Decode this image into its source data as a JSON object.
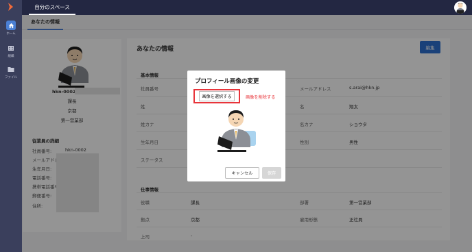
{
  "app": {
    "top_tab": "自分のスペース",
    "sub_tab": "あなたの情報"
  },
  "sidebar": {
    "items": [
      {
        "label": "ホーム",
        "icon": "home-icon"
      },
      {
        "label": "組織",
        "icon": "organization-icon"
      },
      {
        "label": "ファイル",
        "icon": "folder-icon"
      }
    ]
  },
  "profile": {
    "user_id": "hkn-0002・",
    "position": "課長",
    "location": "京都",
    "department": "第一営業部",
    "details_title": "従業員の詳細",
    "details": [
      {
        "label": "社員番号:",
        "value": "hkn-0002"
      },
      {
        "label": "メールアドレス:",
        "value": ""
      },
      {
        "label": "生年月日:",
        "value": ""
      },
      {
        "label": "電話番号:",
        "value": ""
      },
      {
        "label": "携帯電話番号:",
        "value": ""
      },
      {
        "label": "郵便番号:",
        "value": ""
      },
      {
        "label": "住所:",
        "value": ""
      }
    ]
  },
  "main": {
    "title": "あなたの情報",
    "edit_label": "編集",
    "basic": {
      "heading": "基本情報",
      "rows": [
        {
          "l1": "社員番号",
          "v1": "",
          "l2": "メールアドレス",
          "v2": "s.arai@hkn.jp"
        },
        {
          "l1": "姓",
          "v1": "",
          "l2": "名",
          "v2": "翔太"
        },
        {
          "l1": "姓カナ",
          "v1": "",
          "l2": "名カナ",
          "v2": "ショウタ"
        },
        {
          "l1": "生年月日",
          "v1": "",
          "l2": "性別",
          "v2": "男性"
        },
        {
          "l1": "ステータス",
          "v1": "",
          "l2": "",
          "v2": ""
        }
      ]
    },
    "work": {
      "heading": "仕事情報",
      "rows": [
        {
          "l1": "役職",
          "v1": "課長",
          "l2": "部署",
          "v2": "第一営業部"
        },
        {
          "l1": "拠点",
          "v1": "京都",
          "l2": "雇用形態",
          "v2": "正社員"
        },
        {
          "l1": "上司",
          "v1": "-",
          "l2": "",
          "v2": ""
        }
      ]
    }
  },
  "modal": {
    "title": "プロフィール画像の変更",
    "select_label": "画像を選択する",
    "delete_label": "画像を削除する",
    "cancel_label": "キャンセル",
    "save_label": "保存"
  },
  "colors": {
    "sidebar": "#3a3f5c",
    "topbar": "#232742",
    "accent": "#2e71d0",
    "danger": "#e8343a"
  }
}
